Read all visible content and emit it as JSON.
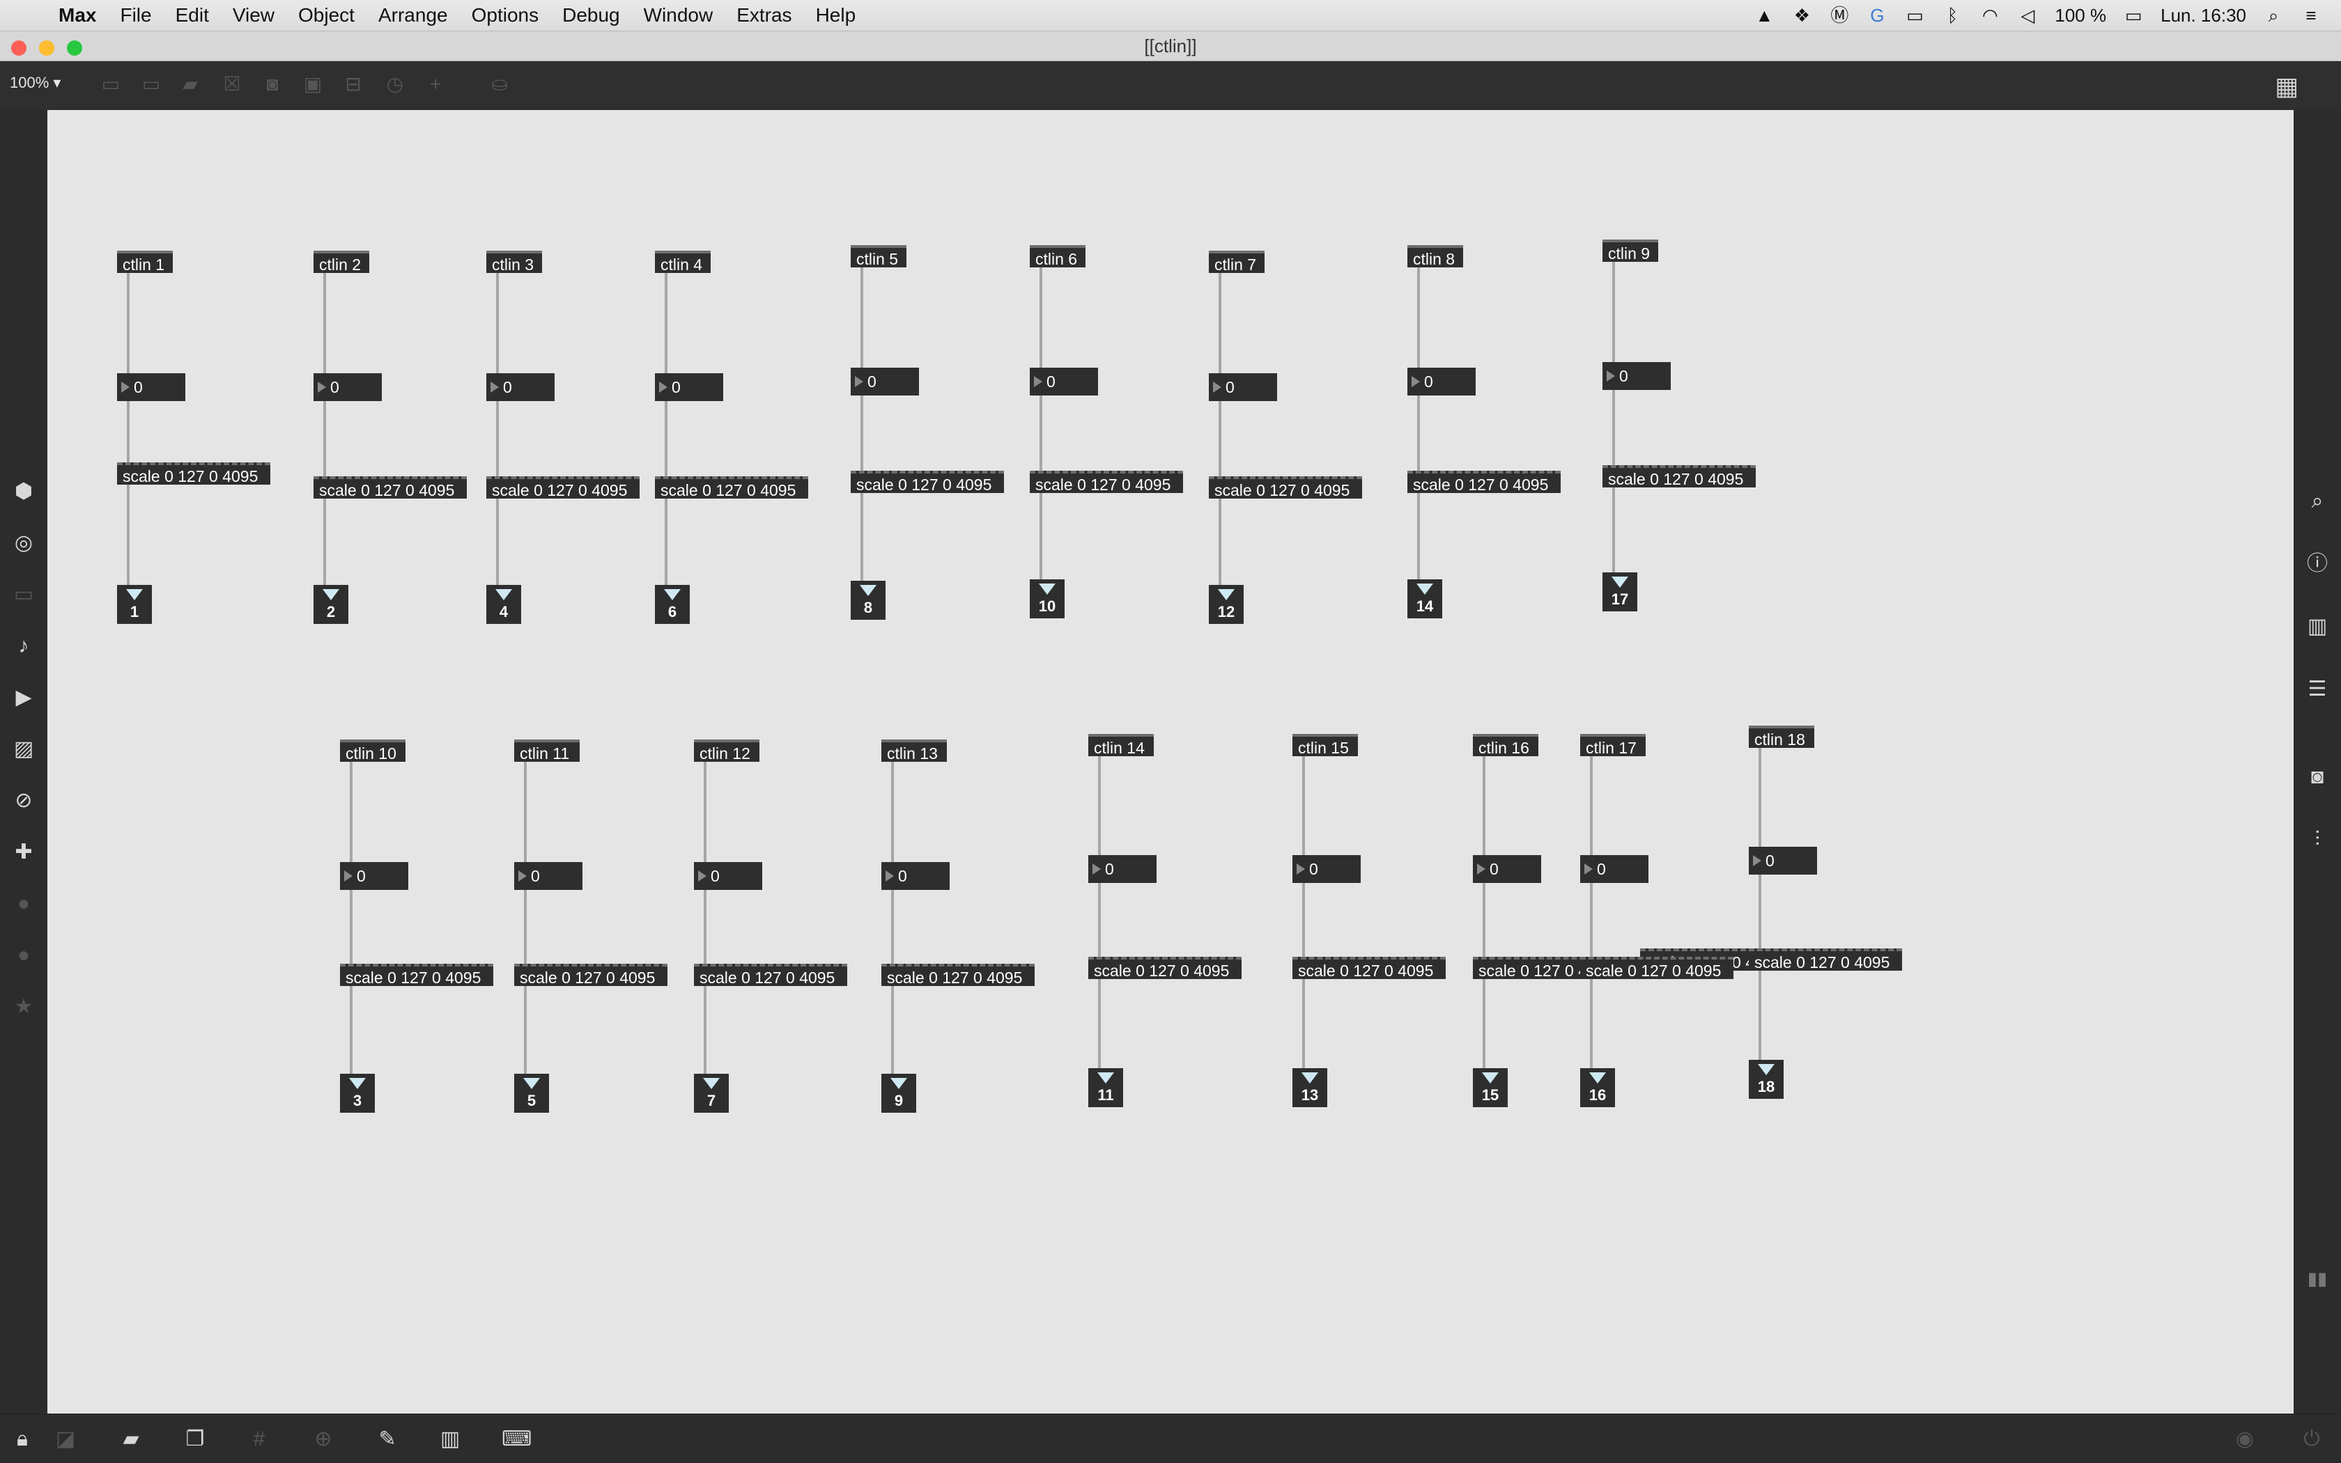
{
  "menubar": {
    "app": "Max",
    "items": [
      "File",
      "Edit",
      "View",
      "Object",
      "Arrange",
      "Options",
      "Debug",
      "Window",
      "Extras",
      "Help"
    ],
    "battery": "100 %",
    "clock": "Lun. 16:30",
    "tray_icons": [
      "vlc-icon",
      "dropbox-icon",
      "m-icon",
      "g-icon",
      "airplay-icon",
      "bluetooth-icon",
      "wifi-icon",
      "volume-icon",
      "battery-icon",
      "spotlight-icon",
      "notification-center-icon"
    ]
  },
  "window": {
    "title": "[[ctlin]]"
  },
  "toolbar": {
    "zoom": "100% ▾"
  },
  "patch": {
    "ctlin": [
      "ctlin 1",
      "ctlin 2",
      "ctlin 3",
      "ctlin 4",
      "ctlin 5",
      "ctlin 6",
      "ctlin 7",
      "ctlin 8",
      "ctlin 9",
      "ctlin 10",
      "ctlin 11",
      "ctlin 12",
      "ctlin 13",
      "ctlin 14",
      "ctlin 15",
      "ctlin 16",
      "ctlin 17",
      "ctlin 18"
    ],
    "number_value": "0",
    "scale_label": "scale 0 127 0 4095",
    "scale_overlap_label": "scale 0 127 0 4095",
    "outlets": [
      "1",
      "2",
      "4",
      "6",
      "8",
      "10",
      "12",
      "14",
      "17",
      "3",
      "5",
      "7",
      "9",
      "11",
      "13",
      "15",
      "16",
      "18"
    ]
  },
  "colors": {
    "canvas": "#e5e5e5",
    "object": "#2e2e2e",
    "cable": "#a6a6a6",
    "outlet_arrow": "#cfe9f2"
  }
}
